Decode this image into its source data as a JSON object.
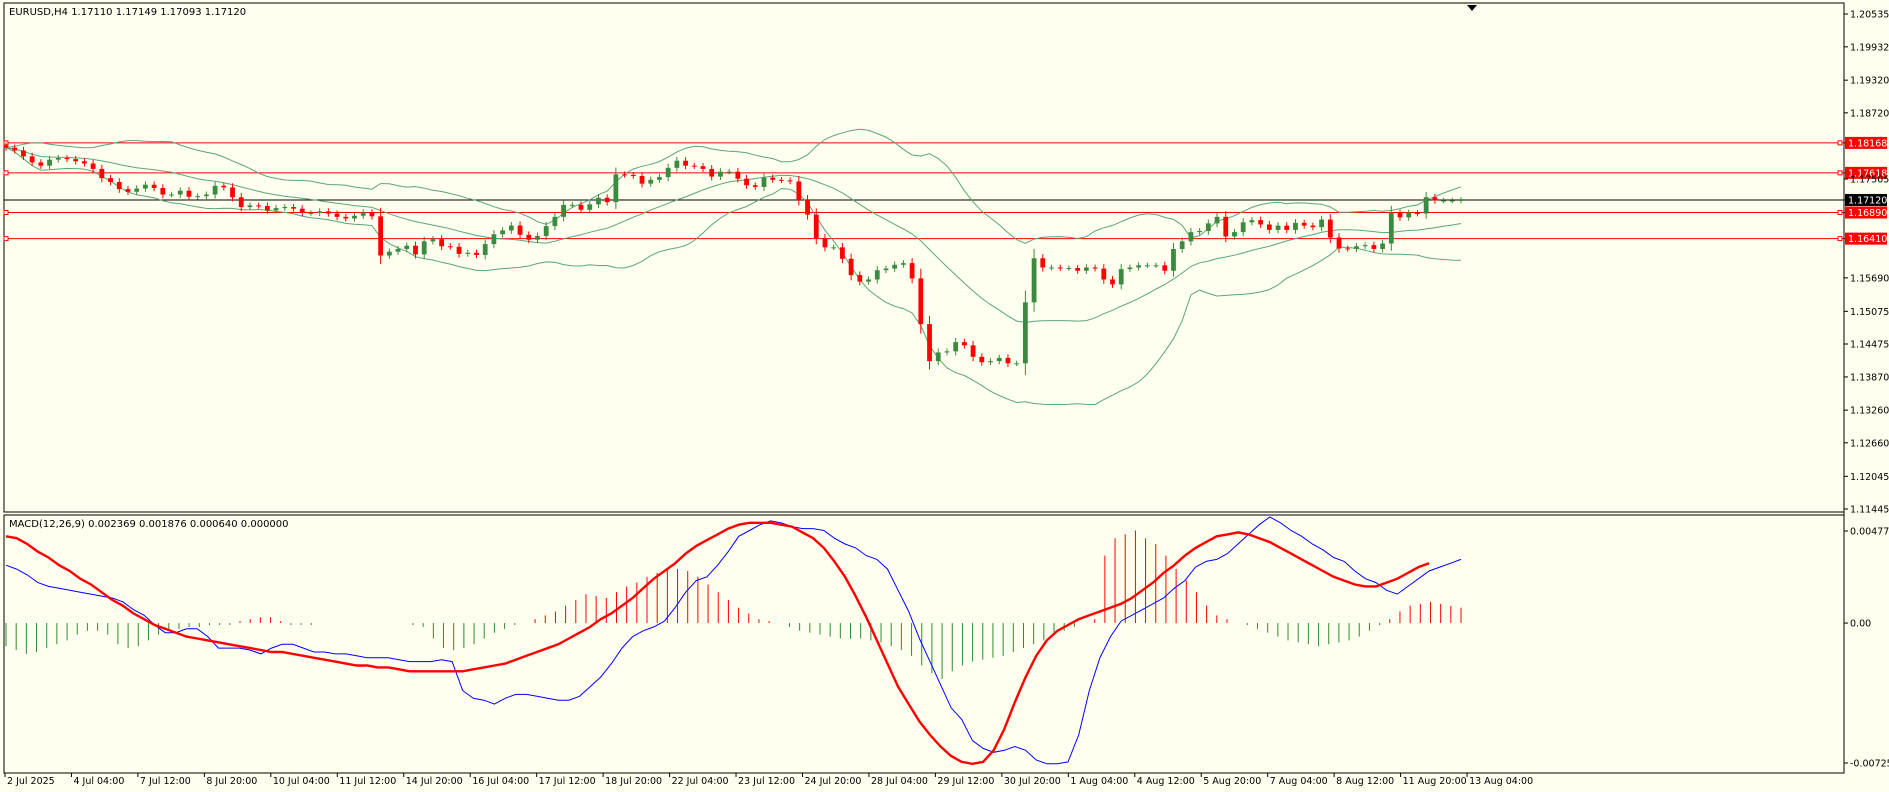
{
  "colors": {
    "background": "#fffff0",
    "bull": "#3a8a3f",
    "bear": "#ff0000",
    "band": "#5aa678",
    "macd_line": "#0000ff",
    "signal_line": "#ff0000",
    "hist_pos": "#ff0000",
    "hist_neg": "#2e8b2e",
    "hline": "#ff0000",
    "current_price_badge": "#000000"
  },
  "header": {
    "symbol_line": "EURUSD,H4  1.17110 1.17149 1.17093 1.17120"
  },
  "macd_header": {
    "label": "MACD(12,26,9) 0.002369 0.001876 0.000640 0.000000"
  },
  "chart_data": [
    {
      "type": "candlestick",
      "title": "EURUSD,H4",
      "ylim": [
        1.11445,
        1.20535
      ],
      "y_ticks": [
        "1.20535",
        "1.19932",
        "1.19320",
        "1.18720",
        "1.18168",
        "1.17618",
        "1.17505",
        "1.17120",
        "1.16890",
        "1.16410",
        "1.15690",
        "1.15075",
        "1.14475",
        "1.13870",
        "1.13260",
        "1.12660",
        "1.12045",
        "1.11445"
      ],
      "horizontal_lines": [
        1.18168,
        1.17618,
        1.1689,
        1.1641
      ],
      "current_price": 1.1712,
      "current_price_label": "1.17120",
      "close_series": [
        1.1808,
        1.1803,
        1.1792,
        1.1781,
        1.1775,
        1.1786,
        1.1789,
        1.1787,
        1.1783,
        1.1779,
        1.1769,
        1.1752,
        1.1745,
        1.1732,
        1.1727,
        1.1733,
        1.174,
        1.1734,
        1.1722,
        1.1722,
        1.1729,
        1.1718,
        1.1719,
        1.1722,
        1.1738,
        1.1735,
        1.1717,
        1.1699,
        1.1702,
        1.1701,
        1.1693,
        1.1697,
        1.1699,
        1.1696,
        1.1688,
        1.1688,
        1.1691,
        1.1687,
        1.1681,
        1.1678,
        1.1683,
        1.1689,
        1.1682,
        1.161,
        1.1617,
        1.1622,
        1.1628,
        1.1612,
        1.1636,
        1.164,
        1.1627,
        1.1626,
        1.1613,
        1.1615,
        1.1611,
        1.1631,
        1.1649,
        1.1656,
        1.1665,
        1.1648,
        1.1639,
        1.1646,
        1.1664,
        1.1681,
        1.1703,
        1.1703,
        1.1694,
        1.1704,
        1.1716,
        1.1708,
        1.1759,
        1.1758,
        1.1756,
        1.1742,
        1.1749,
        1.1754,
        1.1771,
        1.1784,
        1.1775,
        1.1774,
        1.1769,
        1.1755,
        1.1764,
        1.1764,
        1.1751,
        1.1739,
        1.1736,
        1.1753,
        1.1749,
        1.1748,
        1.1746,
        1.1712,
        1.1685,
        1.1642,
        1.1625,
        1.1625,
        1.1604,
        1.1574,
        1.1562,
        1.1566,
        1.1583,
        1.1586,
        1.1593,
        1.1596,
        1.1568,
        1.1484,
        1.1416,
        1.1432,
        1.1434,
        1.1451,
        1.1445,
        1.1424,
        1.1414,
        1.1416,
        1.1422,
        1.1412,
        1.1412,
        1.1524,
        1.1605,
        1.1588,
        1.1588,
        1.1587,
        1.1587,
        1.1582,
        1.1588,
        1.1586,
        1.1566,
        1.1557,
        1.1585,
        1.1588,
        1.1592,
        1.1592,
        1.1592,
        1.1582,
        1.1622,
        1.1636,
        1.1653,
        1.1655,
        1.1669,
        1.1681,
        1.1645,
        1.1653,
        1.1671,
        1.1675,
        1.1667,
        1.1657,
        1.1665,
        1.1657,
        1.167,
        1.1665,
        1.1662,
        1.1676,
        1.1643,
        1.1623,
        1.1622,
        1.1627,
        1.1629,
        1.1622,
        1.1632,
        1.1688,
        1.168,
        1.1688,
        1.1687,
        1.1717,
        1.1711,
        1.1711,
        1.1711,
        1.1712
      ],
      "x_ticks": [
        "2 Jul 2025",
        "4 Jul 04:00",
        "7 Jul 12:00",
        "8 Jul 20:00",
        "10 Jul 04:00",
        "11 Jul 12:00",
        "14 Jul 20:00",
        "16 Jul 04:00",
        "17 Jul 12:00",
        "18 Jul 20:00",
        "22 Jul 04:00",
        "23 Jul 12:00",
        "24 Jul 20:00",
        "28 Jul 04:00",
        "29 Jul 12:00",
        "30 Jul 20:00",
        "1 Aug 04:00",
        "4 Aug 12:00",
        "5 Aug 20:00",
        "7 Aug 04:00",
        "8 Aug 12:00",
        "11 Aug 20:00",
        "13 Aug 04:00"
      ]
    },
    {
      "type": "line",
      "title": "MACD(12,26,9)",
      "ylim": [
        -0.007257,
        0.004774
      ],
      "y_ticks": [
        "0.004774",
        "0.00",
        "-0.007257"
      ],
      "series": [
        {
          "name": "MACD",
          "values": [
            0.003,
            0.0028,
            0.0025,
            0.0021,
            0.0019,
            0.0018,
            0.0017,
            0.0016,
            0.0015,
            0.0014,
            0.0013,
            0.0011,
            0.0007,
            0.0004,
            -0.0001,
            -0.0005,
            -0.0005,
            -0.0003,
            -0.0003,
            -0.0007,
            -0.0013,
            -0.0013,
            -0.0013,
            -0.0014,
            -0.0016,
            -0.0013,
            -0.0011,
            -0.0011,
            -0.0013,
            -0.0015,
            -0.0015,
            -0.0016,
            -0.0016,
            -0.0017,
            -0.0018,
            -0.0018,
            -0.0018,
            -0.0019,
            -0.002,
            -0.002,
            -0.002,
            -0.0019,
            -0.002,
            -0.0035,
            -0.0039,
            -0.004,
            -0.0042,
            -0.0039,
            -0.0037,
            -0.0037,
            -0.0038,
            -0.0039,
            -0.004,
            -0.004,
            -0.0038,
            -0.0033,
            -0.0028,
            -0.0021,
            -0.0013,
            -0.0007,
            -0.0004,
            -0.0002,
            0.0001,
            0.0008,
            0.0016,
            0.0022,
            0.0024,
            0.003,
            0.0037,
            0.0045,
            0.0048,
            0.0051,
            0.0053,
            0.0052,
            0.005,
            0.0049,
            0.0049,
            0.0048,
            0.0044,
            0.0041,
            0.0039,
            0.0035,
            0.0033,
            0.0028,
            0.0017,
            0.0006,
            -0.0008,
            -0.002,
            -0.0032,
            -0.0044,
            -0.005,
            -0.0061,
            -0.0065,
            -0.0067,
            -0.0066,
            -0.0064,
            -0.0066,
            -0.0071,
            -0.0073,
            -0.0073,
            -0.0072,
            -0.0058,
            -0.0035,
            -0.0018,
            -0.0007,
            0.0001,
            0.0004,
            0.0007,
            0.001,
            0.0013,
            0.0018,
            0.0022,
            0.0029,
            0.0032,
            0.0033,
            0.0036,
            0.0041,
            0.0046,
            0.0051,
            0.0055,
            0.0052,
            0.0048,
            0.0045,
            0.0041,
            0.0038,
            0.0034,
            0.0032,
            0.0027,
            0.0023,
            0.0021,
            0.0017,
            0.0015,
            0.0019,
            0.0023,
            0.0027,
            0.0029,
            0.0031,
            0.0033
          ]
        },
        {
          "name": "Signal",
          "values": [
            0.0045,
            0.0044,
            0.0041,
            0.0037,
            0.0034,
            0.003,
            0.0027,
            0.0023,
            0.002,
            0.0016,
            0.0012,
            0.0009,
            0.0005,
            0.0002,
            -0.0001,
            -0.0003,
            -0.0005,
            -0.0007,
            -0.0008,
            -0.0009,
            -0.001,
            -0.0011,
            -0.0012,
            -0.0013,
            -0.0014,
            -0.0015,
            -0.0015,
            -0.0016,
            -0.0017,
            -0.0018,
            -0.0019,
            -0.002,
            -0.0021,
            -0.0022,
            -0.0022,
            -0.0023,
            -0.0023,
            -0.0024,
            -0.0025,
            -0.0025,
            -0.0025,
            -0.0025,
            -0.0025,
            -0.0025,
            -0.0024,
            -0.0023,
            -0.0022,
            -0.0021,
            -0.0019,
            -0.0017,
            -0.0015,
            -0.0013,
            -0.0011,
            -0.0008,
            -0.0005,
            -0.0002,
            0.0002,
            0.0005,
            0.0009,
            0.0013,
            0.0018,
            0.0023,
            0.0027,
            0.0031,
            0.0036,
            0.004,
            0.0043,
            0.0046,
            0.0049,
            0.0051,
            0.0052,
            0.0052,
            0.0052,
            0.0051,
            0.005,
            0.0047,
            0.0044,
            0.0039,
            0.0032,
            0.0024,
            0.0014,
            0.0003,
            -0.0009,
            -0.0021,
            -0.0033,
            -0.0042,
            -0.0051,
            -0.0058,
            -0.0064,
            -0.0069,
            -0.0072,
            -0.0073,
            -0.0072,
            -0.0066,
            -0.0055,
            -0.0041,
            -0.0028,
            -0.0017,
            -0.0009,
            -0.0004,
            -0.0001,
            0.0002,
            0.0004,
            0.0006,
            0.0008,
            0.001,
            0.0013,
            0.0017,
            0.0021,
            0.0026,
            0.003,
            0.0035,
            0.0039,
            0.0042,
            0.0045,
            0.0046,
            0.0047,
            0.0046,
            0.0044,
            0.0042,
            0.0039,
            0.0036,
            0.0033,
            0.003,
            0.0027,
            0.0024,
            0.0022,
            0.002,
            0.0019,
            0.0019,
            0.0021,
            0.0023,
            0.0026,
            0.0029,
            0.0031
          ]
        },
        {
          "name": "Histogram",
          "values": [
            -0.0012,
            -0.0014,
            -0.0016,
            -0.0015,
            -0.0013,
            -0.0011,
            -0.0009,
            -0.0006,
            -0.0004,
            -0.0004,
            -0.0006,
            -0.0011,
            -0.0013,
            -0.0012,
            -0.0009,
            -0.0006,
            -0.0004,
            -0.0003,
            -0.0002,
            -0.0002,
            -0.0001,
            -0.0001,
            -0.0001,
            0.0001,
            0.0002,
            0.0003,
            0.0003,
            0.0001,
            -0.0001,
            -0.0001,
            -0.0001,
            0.0,
            0.0,
            0.0,
            0.0,
            0.0,
            0.0,
            0.0,
            0.0,
            0.0,
            -0.0001,
            -0.0002,
            -0.0008,
            -0.0013,
            -0.0014,
            -0.0013,
            -0.0011,
            -0.0008,
            -0.0005,
            -0.0003,
            -0.0001,
            0.0,
            0.0002,
            0.0004,
            0.0006,
            0.0009,
            0.0012,
            0.0015,
            0.0014,
            0.0013,
            0.0016,
            0.0019,
            0.0021,
            0.0024,
            0.0026,
            0.0028,
            0.0028,
            0.0027,
            0.0024,
            0.002,
            0.0016,
            0.0012,
            0.0008,
            0.0005,
            0.0002,
            0.0001,
            0.0,
            -0.0002,
            -0.0004,
            -0.0005,
            -0.0006,
            -0.0007,
            -0.0008,
            -0.0008,
            -0.0008,
            -0.0009,
            -0.001,
            -0.0012,
            -0.0014,
            -0.0017,
            -0.0022,
            -0.0026,
            -0.0029,
            -0.0025,
            -0.0022,
            -0.002,
            -0.0019,
            -0.0018,
            -0.0017,
            -0.0015,
            -0.0013,
            -0.0011,
            -0.0009,
            -0.0006,
            -0.0004,
            -0.0002,
            0.0,
            0.0002,
            0.0035,
            0.0044,
            0.0046,
            0.0048,
            0.0044,
            0.0041,
            0.0035,
            0.0028,
            0.0022,
            0.0016,
            0.0009,
            0.0004,
            0.0002,
            0.0,
            -0.0001,
            -0.0003,
            -0.0005,
            -0.0007,
            -0.0009,
            -0.001,
            -0.0011,
            -0.0012,
            -0.0011,
            -0.001,
            -0.0009,
            -0.0007,
            -0.0004,
            -0.0001,
            0.0002,
            0.0006,
            0.0009,
            0.001,
            0.0011,
            0.001,
            0.0009,
            0.0008
          ]
        }
      ]
    }
  ]
}
